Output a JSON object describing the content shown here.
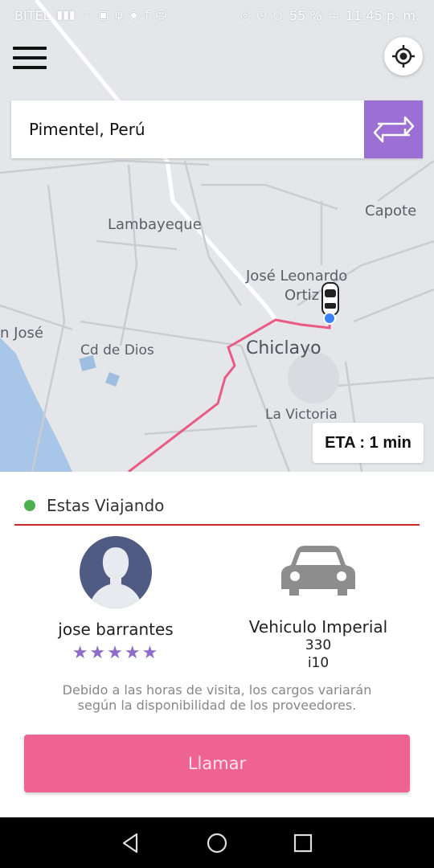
{
  "status_bar": {
    "carrier": "BITEL",
    "battery_percent": "55 %",
    "time": "11:45 p. m."
  },
  "search": {
    "value": "Pimentel, Perú"
  },
  "map": {
    "labels": {
      "capote": "Capote",
      "lambayeque": "Lambayeque",
      "jose_leonardo_ortiz_1": "José Leonardo",
      "jose_leonardo_ortiz_2": "Ortiz",
      "san_jose": "n José",
      "cd_de_dios": "Cd de Dios",
      "chiclayo": "Chiclayo",
      "la_victoria": "La Victoria"
    },
    "eta": "ETA : 1 min",
    "route_color": "#e95b84",
    "vehicle_marker_color": "#3b82f6"
  },
  "trip": {
    "status": "Estas Viajando",
    "status_color": "#4caf50"
  },
  "driver": {
    "name": "jose barrantes",
    "rating": 5,
    "stars": "★★★★★"
  },
  "vehicle": {
    "name": "Vehiculo Imperial",
    "line1": "330",
    "line2": "i10"
  },
  "notice": {
    "line1": "Debido a las horas de visita, los cargos variarán",
    "line2": "según la disponibilidad de los proveedores."
  },
  "actions": {
    "call_label": "Llamar"
  },
  "colors": {
    "accent_purple": "#9b6fd4",
    "call_button": "#ef6392",
    "divider": "#c62828"
  }
}
